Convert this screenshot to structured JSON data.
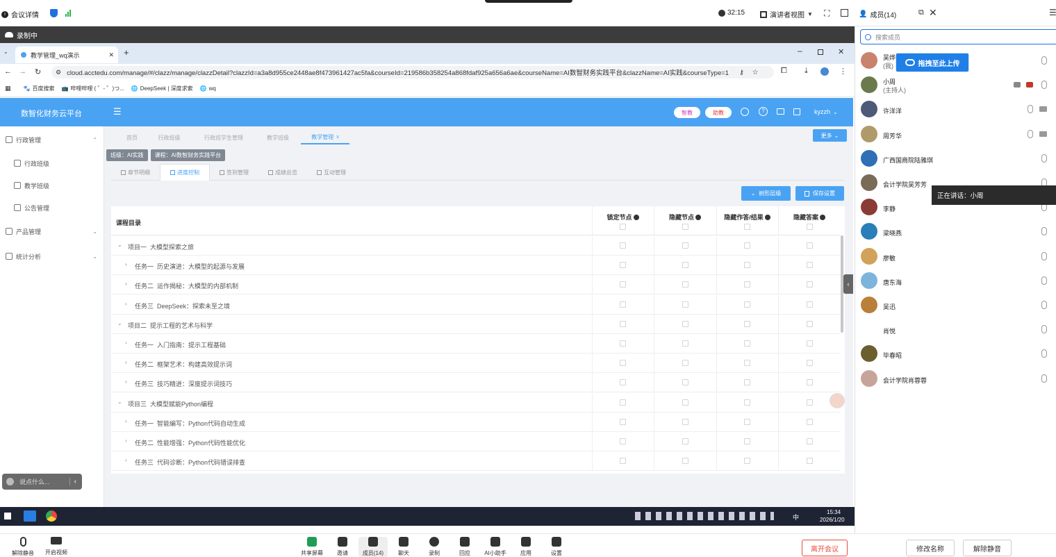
{
  "meeting": {
    "info_label": "会议详情",
    "timer": "32:15",
    "view_mode": "演讲者视图",
    "members_label": "成员(14)",
    "recording": "录制中",
    "speaking": "正在讲话：小周",
    "comment_placeholder": "说点什么...",
    "bottom": {
      "unmute": "解除静音",
      "video": "开启视频",
      "share": "共享屏幕",
      "invite": "邀请",
      "members": "成员(14)",
      "chat": "聊天",
      "record": "录制",
      "react": "回应",
      "ai": "AI小助手",
      "apps": "应用",
      "settings": "设置",
      "leave": "离开会议",
      "rename": "修改名称",
      "unmute_me": "解除静音"
    }
  },
  "members": {
    "search_placeholder": "搜索成员",
    "upload_tip": "拖拽至此上传",
    "list": [
      {
        "name": "吴烨",
        "role": "(我)",
        "color": "#c9826b"
      },
      {
        "name": "小周",
        "role": "(主持人)",
        "color": "#6b7a4d"
      },
      {
        "name": "许洋洋",
        "role": "",
        "color": "#4d5a78"
      },
      {
        "name": "周芳华",
        "role": "",
        "color": "#b09a6a"
      },
      {
        "name": "广西国商院陆雅琪",
        "role": "",
        "color": "#2e6fb5"
      },
      {
        "name": "会计学院吴芳芳",
        "role": "",
        "color": "#7a6a58"
      },
      {
        "name": "李静",
        "role": "",
        "color": "#8a3b36"
      },
      {
        "name": "梁晓燕",
        "role": "",
        "color": "#2a7fb8"
      },
      {
        "name": "廖敏",
        "role": "",
        "color": "#d1a25a"
      },
      {
        "name": "唐东海",
        "role": "",
        "color": "#7db4dc"
      },
      {
        "name": "吴迅",
        "role": "",
        "color": "#b9803a"
      },
      {
        "name": "肖悦",
        "role": "",
        "color": "#ffffff"
      },
      {
        "name": "毕春昭",
        "role": "",
        "color": "#6b5e2f"
      },
      {
        "name": "会计学院肖蓉蓉",
        "role": "",
        "color": "#c7a49a"
      }
    ]
  },
  "browser": {
    "tab_title": "教学管理_wq演示",
    "url": "cloud.acctedu.com/manage/#/clazz/manage/clazzDetail?clazzId=a3a8d955ce2448ae8f473961427ac5fa&courseId=219586b358254a868fdaf925a656a6ae&courseName=AI数智财务实践平台&clazzName=AI实践&courseType=1",
    "bookmarks": [
      "百度搜索",
      "哔哩哔哩 ( ゜- ゜)つ...",
      "DeepSeek | 深度求索",
      "wq"
    ]
  },
  "app": {
    "brand": "数智化财务云平台",
    "badge1": "智教",
    "badge2": "助教",
    "user": "kyzzh",
    "sidebar": [
      {
        "label": "行政管理",
        "level": 0
      },
      {
        "label": "行政班级",
        "level": 1
      },
      {
        "label": "教学班级",
        "level": 1
      },
      {
        "label": "公告管理",
        "level": 1
      },
      {
        "label": "产品管理",
        "level": 0
      },
      {
        "label": "统计分析",
        "level": 0
      }
    ],
    "page_tabs": [
      "首页",
      "行政班级",
      "行政班学生管理",
      "教学班级",
      "教学管理"
    ],
    "more": "更多",
    "tags": [
      "班级：AI实践",
      "课程：AI数智财务实践平台"
    ],
    "sub_tabs": [
      "章节明细",
      "进度控制",
      "签到管理",
      "成绩总览",
      "互动管理"
    ],
    "buttons": {
      "tree": "树形层级",
      "save": "保存设置"
    },
    "table": {
      "headers": [
        "课程目录",
        "锁定节点",
        "隐藏节点",
        "隐藏作答/结果",
        "隐藏答案"
      ],
      "rows": [
        {
          "text": "项目一  大模型探索之旅",
          "level": 0
        },
        {
          "text": "任务一  历史演进：大模型的起源与发展",
          "level": 1
        },
        {
          "text": "任务二  运作揭秘：大模型的内部机制",
          "level": 1
        },
        {
          "text": "任务三  DeepSeek：探索未至之境",
          "level": 1
        },
        {
          "text": "项目二  提示工程的艺术与科学",
          "level": 0
        },
        {
          "text": "任务一  入门指南：提示工程基础",
          "level": 1
        },
        {
          "text": "任务二  框架艺术：构建高效提示词",
          "level": 1
        },
        {
          "text": "任务三  技巧精进：深度提示词技巧",
          "level": 1
        },
        {
          "text": "项目三  大模型赋能Python编程",
          "level": 0
        },
        {
          "text": "任务一  智能编写：Python代码自动生成",
          "level": 1
        },
        {
          "text": "任务二  性能增强：Python代码性能优化",
          "level": 1
        },
        {
          "text": "任务三  代码诊断：Python代码错误排查",
          "level": 1
        }
      ]
    }
  },
  "taskbar": {
    "time": "15:34",
    "date": "2026/1/20",
    "ime": "中"
  }
}
